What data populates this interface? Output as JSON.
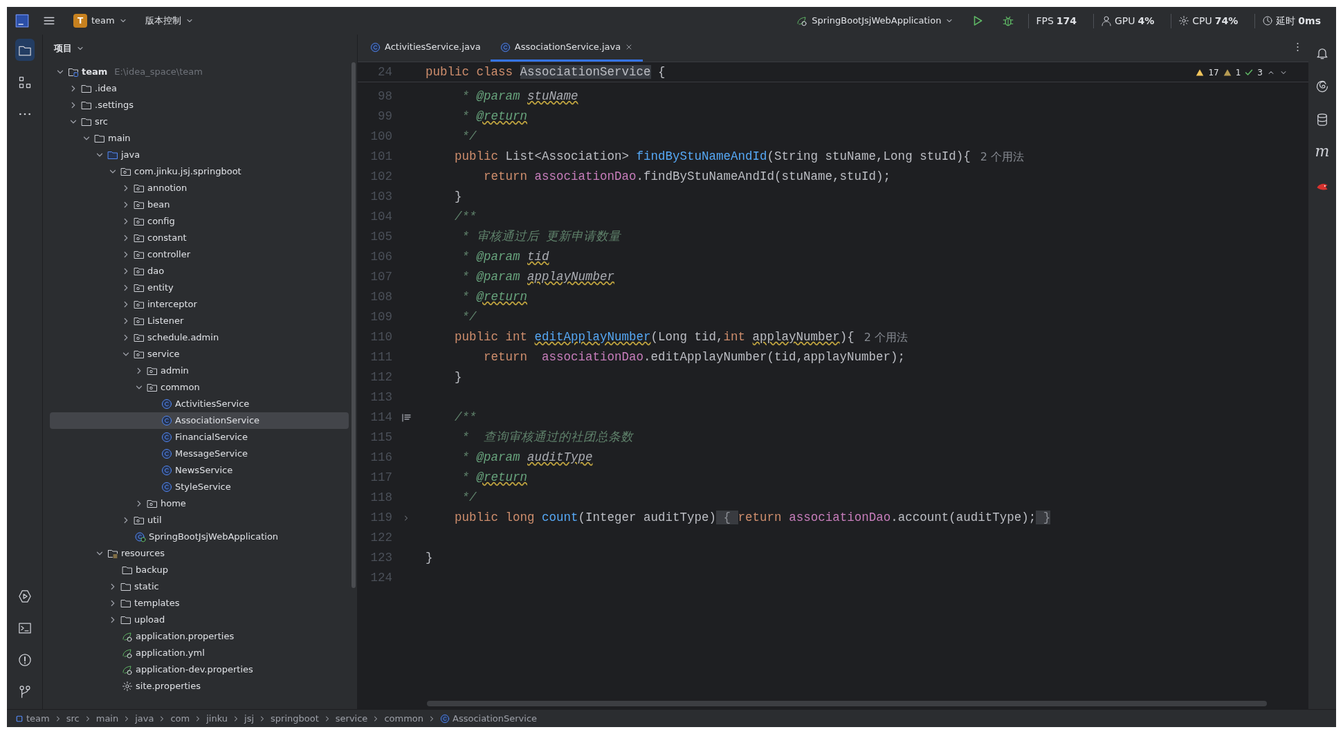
{
  "toolbar": {
    "project_badge": "T",
    "project_name": "team",
    "vcs": "版本控制",
    "run_config": "SpringBootJsjWebApplication",
    "monitors": [
      {
        "kind": "fps",
        "label": "FPS",
        "value": "174"
      },
      {
        "kind": "gpu",
        "label": "GPU",
        "value": "4%"
      },
      {
        "kind": "cpu",
        "label": "CPU",
        "value": "74%"
      },
      {
        "kind": "latency",
        "label": "延时",
        "value": "0ms"
      }
    ]
  },
  "project_panel": {
    "title": "项目",
    "tree": [
      {
        "label": "team",
        "path": "E:\\idea_space\\team",
        "kind": "module",
        "expanded": true,
        "selected": false,
        "children": [
          {
            "label": ".idea",
            "kind": "folder",
            "expanded": false,
            "selected": false
          },
          {
            "label": ".settings",
            "kind": "folder",
            "expanded": false,
            "selected": false
          },
          {
            "label": "src",
            "kind": "folder",
            "expanded": true,
            "selected": false,
            "children": [
              {
                "label": "main",
                "kind": "folder",
                "expanded": true,
                "selected": false,
                "children": [
                  {
                    "label": "java",
                    "kind": "source_root",
                    "expanded": true,
                    "selected": false,
                    "children": [
                      {
                        "label": "com.jinku.jsj.springboot",
                        "kind": "package",
                        "expanded": true,
                        "selected": false,
                        "children": [
                          {
                            "label": "annotion",
                            "kind": "package",
                            "expanded": false,
                            "selected": false
                          },
                          {
                            "label": "bean",
                            "kind": "package",
                            "expanded": false,
                            "selected": false
                          },
                          {
                            "label": "config",
                            "kind": "package",
                            "expanded": false,
                            "selected": false
                          },
                          {
                            "label": "constant",
                            "kind": "package",
                            "expanded": false,
                            "selected": false
                          },
                          {
                            "label": "controller",
                            "kind": "package",
                            "expanded": false,
                            "selected": false
                          },
                          {
                            "label": "dao",
                            "kind": "package",
                            "expanded": false,
                            "selected": false
                          },
                          {
                            "label": "entity",
                            "kind": "package",
                            "expanded": false,
                            "selected": false
                          },
                          {
                            "label": "interceptor",
                            "kind": "package",
                            "expanded": false,
                            "selected": false
                          },
                          {
                            "label": "Listener",
                            "kind": "package",
                            "expanded": false,
                            "selected": false
                          },
                          {
                            "label": "schedule.admin",
                            "kind": "package",
                            "expanded": false,
                            "selected": false
                          },
                          {
                            "label": "service",
                            "kind": "package",
                            "expanded": true,
                            "selected": false,
                            "children": [
                              {
                                "label": "admin",
                                "kind": "package",
                                "expanded": false,
                                "selected": false
                              },
                              {
                                "label": "common",
                                "kind": "package",
                                "expanded": true,
                                "selected": false,
                                "children": [
                                  {
                                    "label": "ActivitiesService",
                                    "kind": "class",
                                    "selected": false
                                  },
                                  {
                                    "label": "AssociationService",
                                    "kind": "class",
                                    "selected": true
                                  },
                                  {
                                    "label": "FinancialService",
                                    "kind": "class",
                                    "selected": false
                                  },
                                  {
                                    "label": "MessageService",
                                    "kind": "class",
                                    "selected": false
                                  },
                                  {
                                    "label": "NewsService",
                                    "kind": "class",
                                    "selected": false
                                  },
                                  {
                                    "label": "StyleService",
                                    "kind": "class",
                                    "selected": false
                                  }
                                ]
                              },
                              {
                                "label": "home",
                                "kind": "package",
                                "expanded": false,
                                "selected": false
                              }
                            ]
                          },
                          {
                            "label": "util",
                            "kind": "package",
                            "expanded": false,
                            "selected": false
                          },
                          {
                            "label": "SpringBootJsjWebApplication",
                            "kind": "spring_class",
                            "selected": false
                          }
                        ]
                      }
                    ]
                  },
                  {
                    "label": "resources",
                    "kind": "resource_root",
                    "expanded": true,
                    "selected": false,
                    "children": [
                      {
                        "label": "backup",
                        "kind": "folder",
                        "selected": false
                      },
                      {
                        "label": "static",
                        "kind": "folder",
                        "expanded": false,
                        "selected": false
                      },
                      {
                        "label": "templates",
                        "kind": "folder",
                        "expanded": false,
                        "selected": false
                      },
                      {
                        "label": "upload",
                        "kind": "folder",
                        "expanded": false,
                        "selected": false
                      },
                      {
                        "label": "application.properties",
                        "kind": "spring_config",
                        "selected": false
                      },
                      {
                        "label": "application.yml",
                        "kind": "spring_config",
                        "selected": false
                      },
                      {
                        "label": "application-dev.properties",
                        "kind": "spring_config",
                        "selected": false
                      },
                      {
                        "label": "site.properties",
                        "kind": "settings_file",
                        "selected": false
                      }
                    ]
                  }
                ]
              }
            ]
          }
        ]
      }
    ]
  },
  "tabs": [
    {
      "label": "ActivitiesService.java",
      "selected": false
    },
    {
      "label": "AssociationService.java",
      "selected": true
    }
  ],
  "editor": {
    "inspections": {
      "warnings": "17",
      "weak_warnings": "1",
      "passed": "3"
    },
    "sticky_line": {
      "number": "24",
      "tokens": [
        {
          "text": "public class ",
          "kind": "keyword"
        },
        {
          "text": "AssociationService",
          "kind": "highlight"
        },
        {
          "text": " {",
          "kind": "plain"
        }
      ]
    },
    "lines": [
      {
        "number": "98",
        "tokens": [
          {
            "text": "     * ",
            "kind": "doc"
          },
          {
            "text": "@param ",
            "kind": "doctag"
          },
          {
            "text": "stuName",
            "kind": "docparam"
          }
        ]
      },
      {
        "number": "99",
        "tokens": [
          {
            "text": "     * ",
            "kind": "doc"
          },
          {
            "text": "@return",
            "kind": "doctag_warn"
          }
        ]
      },
      {
        "number": "100",
        "tokens": [
          {
            "text": "     */",
            "kind": "doc"
          }
        ]
      },
      {
        "number": "101",
        "tokens": [
          {
            "text": "    public ",
            "kind": "keyword"
          },
          {
            "text": "List<Association> ",
            "kind": "plain"
          },
          {
            "text": "findByStuNameAndId",
            "kind": "method"
          },
          {
            "text": "(String stuName,Long stuId){",
            "kind": "plain"
          }
        ],
        "hint": "2 个用法"
      },
      {
        "number": "102",
        "tokens": [
          {
            "text": "        return ",
            "kind": "keyword"
          },
          {
            "text": "associationDao",
            "kind": "field"
          },
          {
            "text": ".findByStuNameAndId(stuName,stuId);",
            "kind": "plain"
          }
        ]
      },
      {
        "number": "103",
        "tokens": [
          {
            "text": "    }",
            "kind": "plain"
          }
        ]
      },
      {
        "number": "104",
        "tokens": [
          {
            "text": "    /**",
            "kind": "doc"
          }
        ]
      },
      {
        "number": "105",
        "tokens": [
          {
            "text": "     * 审核通过后 更新申请数量",
            "kind": "doc"
          }
        ]
      },
      {
        "number": "106",
        "tokens": [
          {
            "text": "     * ",
            "kind": "doc"
          },
          {
            "text": "@param ",
            "kind": "doctag"
          },
          {
            "text": "tid",
            "kind": "docparam"
          }
        ]
      },
      {
        "number": "107",
        "tokens": [
          {
            "text": "     * ",
            "kind": "doc"
          },
          {
            "text": "@param ",
            "kind": "doctag"
          },
          {
            "text": "applayNumber",
            "kind": "docparam"
          }
        ]
      },
      {
        "number": "108",
        "tokens": [
          {
            "text": "     * ",
            "kind": "doc"
          },
          {
            "text": "@return",
            "kind": "doctag_warn"
          }
        ]
      },
      {
        "number": "109",
        "tokens": [
          {
            "text": "     */",
            "kind": "doc"
          }
        ]
      },
      {
        "number": "110",
        "tokens": [
          {
            "text": "    public int ",
            "kind": "keyword"
          },
          {
            "text": "editApplayNumber",
            "kind": "method_warn"
          },
          {
            "text": "(Long tid,",
            "kind": "plain"
          },
          {
            "text": "int ",
            "kind": "keyword"
          },
          {
            "text": "applayNumber",
            "kind": "plain_warn"
          },
          {
            "text": "){",
            "kind": "plain"
          }
        ],
        "hint": "2 个用法"
      },
      {
        "number": "111",
        "tokens": [
          {
            "text": "        return  ",
            "kind": "keyword"
          },
          {
            "text": "associationDao",
            "kind": "field"
          },
          {
            "text": ".editApplayNumber(tid,applayNumber);",
            "kind": "plain"
          }
        ]
      },
      {
        "number": "112",
        "tokens": [
          {
            "text": "    }",
            "kind": "plain"
          }
        ]
      },
      {
        "number": "113"
      },
      {
        "number": "114",
        "rendered_doc": true,
        "tokens": [
          {
            "text": "    /**",
            "kind": "doc"
          }
        ]
      },
      {
        "number": "115",
        "tokens": [
          {
            "text": "     *  查询审核通过的社团总条数",
            "kind": "doc"
          }
        ]
      },
      {
        "number": "116",
        "tokens": [
          {
            "text": "     * ",
            "kind": "doc"
          },
          {
            "text": "@param ",
            "kind": "doctag"
          },
          {
            "text": "auditType",
            "kind": "docparam"
          }
        ]
      },
      {
        "number": "117",
        "tokens": [
          {
            "text": "     * ",
            "kind": "doc"
          },
          {
            "text": "@return",
            "kind": "doctag_warn"
          }
        ]
      },
      {
        "number": "118",
        "tokens": [
          {
            "text": "     */",
            "kind": "doc"
          }
        ]
      },
      {
        "number": "119",
        "collapsed": true,
        "tokens": [
          {
            "text": "    public long ",
            "kind": "keyword"
          },
          {
            "text": "count",
            "kind": "method"
          },
          {
            "text": "(Integer auditType)",
            "kind": "plain"
          },
          {
            "text": " { ",
            "kind": "folded"
          },
          {
            "text": "return ",
            "kind": "keyword"
          },
          {
            "text": "associationDao",
            "kind": "field"
          },
          {
            "text": ".account(auditType);",
            "kind": "plain"
          },
          {
            "text": " }",
            "kind": "folded"
          }
        ]
      },
      {
        "number": "122"
      },
      {
        "number": "123",
        "tokens": [
          {
            "text": "}",
            "kind": "plain"
          }
        ]
      },
      {
        "number": "124"
      }
    ]
  },
  "breadcrumbs": [
    {
      "label": "team",
      "kind": "module"
    },
    {
      "label": "src",
      "kind": "plain"
    },
    {
      "label": "main",
      "kind": "plain"
    },
    {
      "label": "java",
      "kind": "plain"
    },
    {
      "label": "com",
      "kind": "plain"
    },
    {
      "label": "jinku",
      "kind": "plain"
    },
    {
      "label": "jsj",
      "kind": "plain"
    },
    {
      "label": "springboot",
      "kind": "plain"
    },
    {
      "label": "service",
      "kind": "plain"
    },
    {
      "label": "common",
      "kind": "plain"
    },
    {
      "label": "AssociationService",
      "kind": "class"
    }
  ],
  "right_toolbar": [
    {
      "kind": "notifications"
    },
    {
      "kind": "ai"
    },
    {
      "kind": "database"
    },
    {
      "kind": "maven",
      "glyph": "m"
    },
    {
      "kind": "bird"
    }
  ]
}
